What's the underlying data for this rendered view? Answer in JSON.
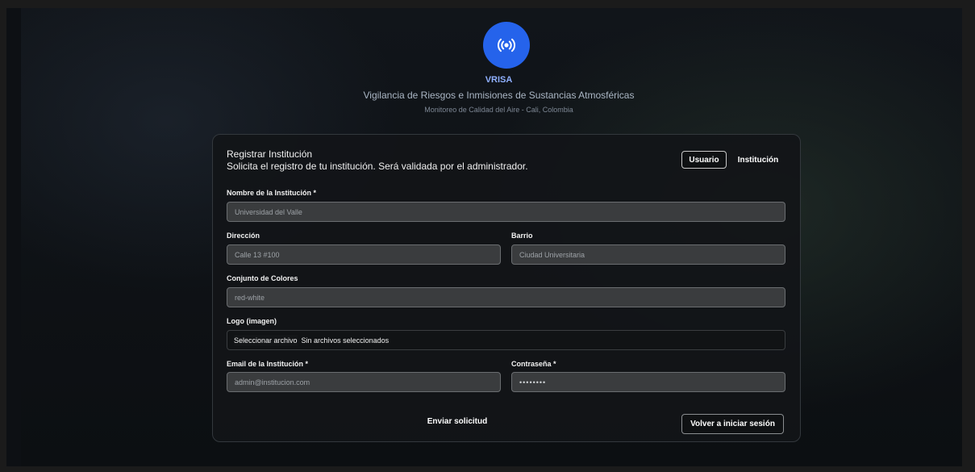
{
  "brand": {
    "icon": "broadcast-icon",
    "name": "VRISA",
    "subtitle": "Vigilancia de Riesgos e Inmisiones de Sustancias Atmosféricas",
    "location": "Monitoreo de Calidad del Aire - Cali, Colombia",
    "accent_color": "#2563eb"
  },
  "card": {
    "title": "Registrar Institución",
    "description": "Solicita el registro de tu institución. Será validada por el administrador.",
    "toggle": {
      "user_label": "Usuario",
      "institution_label": "Institución",
      "active": "Usuario"
    }
  },
  "form": {
    "name": {
      "label": "Nombre de la Institución *",
      "placeholder": "Universidad del Valle",
      "value": ""
    },
    "address": {
      "label": "Dirección",
      "placeholder": "Calle 13 #100",
      "value": ""
    },
    "neighborhood": {
      "label": "Barrio",
      "placeholder": "Ciudad Universitaria",
      "value": ""
    },
    "colors": {
      "label": "Conjunto de Colores",
      "placeholder": "red-white",
      "value": ""
    },
    "logo": {
      "label": "Logo (imagen)",
      "button_label": "Seleccionar archivo",
      "status": "Sin archivos seleccionados"
    },
    "email": {
      "label": "Email de la Institución *",
      "placeholder": "admin@institucion.com",
      "value": ""
    },
    "password": {
      "label": "Contraseña *",
      "placeholder": "••••••••",
      "value": ""
    }
  },
  "actions": {
    "submit_label": "Enviar solicitud",
    "back_label": "Volver a iniciar sesión"
  }
}
